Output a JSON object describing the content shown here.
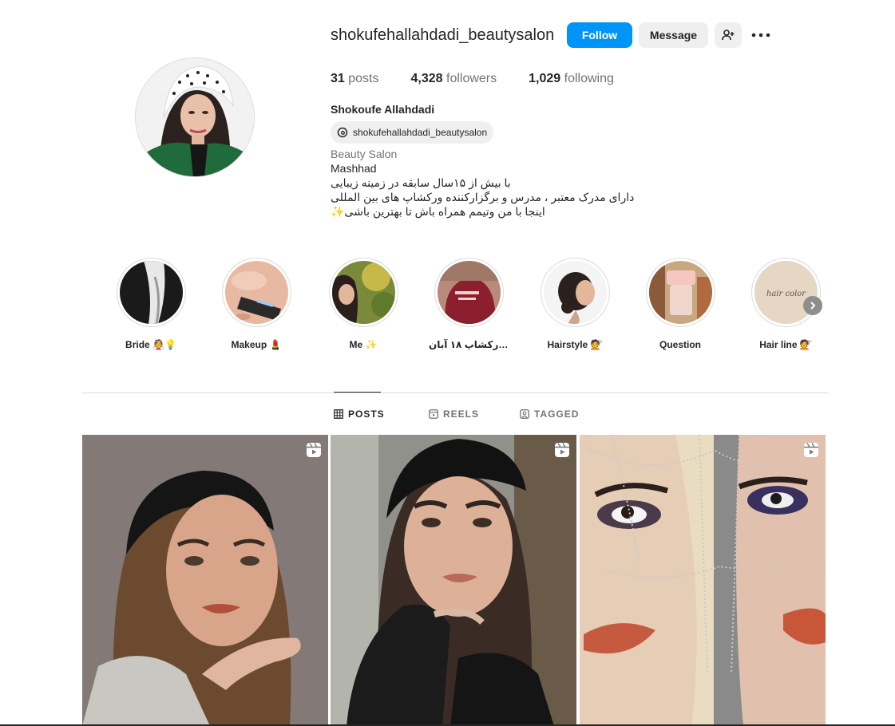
{
  "profile": {
    "username": "shokufehallahdadi_beautysalon",
    "full_name": "Shokoufe Allahdadi",
    "threads_handle": "shokufehallahdadi_beautysalon",
    "category": "Beauty Salon",
    "bio_lines": [
      "Mashhad",
      "با بیش از ۱۵سال سابقه در زمینه زیبایی",
      "دارای مدرک معتبر ، مدرس و برگزارکننده ورکشاپ های بین المللی",
      "اینجا با من وتیمم همراه باش تا بهترین باشی✨"
    ],
    "avatar_icon": "profile-photo"
  },
  "actions": {
    "follow_label": "Follow",
    "message_label": "Message",
    "add_user_icon": "add-user-icon",
    "more_icon": "more-options-icon"
  },
  "stats": {
    "posts_count": "31",
    "posts_label": "posts",
    "followers_count": "4,328",
    "followers_label": "followers",
    "following_count": "1,029",
    "following_label": "following"
  },
  "highlights": [
    {
      "label": "Bride 👰💡"
    },
    {
      "label": "Makeup 💄"
    },
    {
      "label": "Me ✨"
    },
    {
      "label": "ورکشاپ ۱۸ آبان..."
    },
    {
      "label": "Hairstyle 💇"
    },
    {
      "label": "Question"
    },
    {
      "label": "Hair line 💇"
    }
  ],
  "highlight_cover_text": "hair color",
  "tabs": [
    {
      "label": "POSTS",
      "icon": "grid-icon",
      "active": true
    },
    {
      "label": "REELS",
      "icon": "reels-icon",
      "active": false
    },
    {
      "label": "TAGGED",
      "icon": "tagged-icon",
      "active": false
    }
  ],
  "posts": [
    {
      "type": "reel",
      "icon": "reel-icon"
    },
    {
      "type": "reel",
      "icon": "reel-icon"
    },
    {
      "type": "reel",
      "icon": "reel-icon"
    }
  ],
  "colors": {
    "primary_blue": "#0095f6",
    "secondary_bg": "#efefef",
    "text_primary": "#262626",
    "text_secondary": "#737373"
  }
}
